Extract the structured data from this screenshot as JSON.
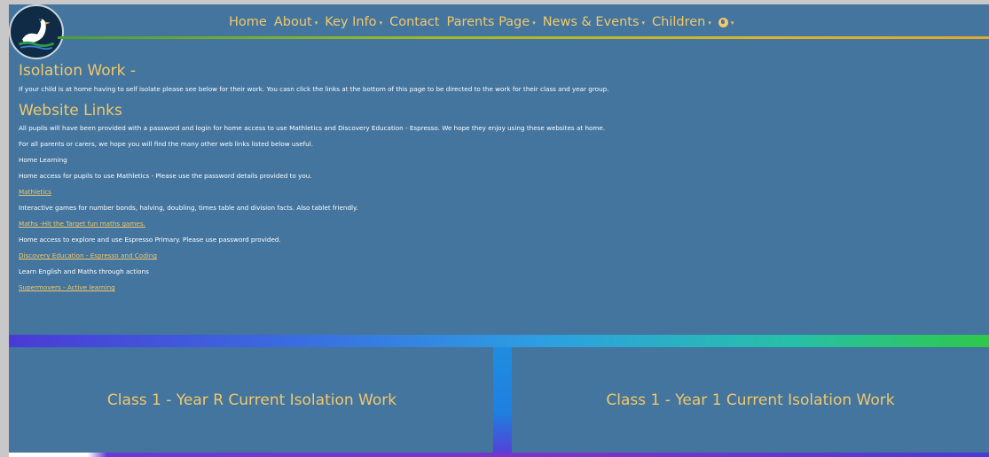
{
  "nav": {
    "items": [
      {
        "label": "Home",
        "dropdown": false
      },
      {
        "label": "About",
        "dropdown": true
      },
      {
        "label": "Key Info",
        "dropdown": true
      },
      {
        "label": "Contact",
        "dropdown": false
      },
      {
        "label": "Parents Page",
        "dropdown": true
      },
      {
        "label": "News & Events",
        "dropdown": true
      },
      {
        "label": "Children",
        "dropdown": true
      }
    ],
    "caret": "▾"
  },
  "content": {
    "isolation_title": "Isolation Work -",
    "isolation_text": "If your child is at home having to self isolate please see below for their work. You casn click the links at the bottom of this page to be directed to the work for their class and year group.",
    "links_title": "Website Links",
    "lines": [
      {
        "type": "text",
        "text": "All pupils will have been provided with a password and login for home access to use Mathletics and Discovery Education - Espresso. We hope they enjoy using these websites at home."
      },
      {
        "type": "text",
        "text": "For all parents or carers, we hope you will find the many other web links listed below useful."
      },
      {
        "type": "text",
        "text": "Home Learning"
      },
      {
        "type": "text",
        "text": "Home access for pupils to use Mathletics - Please use the password details provided to you."
      },
      {
        "type": "link",
        "text": "Mathletics"
      },
      {
        "type": "text",
        "text": "Interactive games for number bonds, halving, doubling, times table and division facts. Also tablet friendly."
      },
      {
        "type": "link",
        "text": "Maths -Hit the Target fun maths games."
      },
      {
        "type": "text",
        "text": "Home access to explore and use Espresso Primary. Please use password provided."
      },
      {
        "type": "link",
        "text": "Discovery Education - Espresso and Coding"
      },
      {
        "type": "text",
        "text": "Learn English and Maths through actions"
      },
      {
        "type": "link",
        "text": "Supermovers - Active learning"
      }
    ]
  },
  "cards": [
    {
      "label": "Class 1 - Year R Current Isolation Work"
    },
    {
      "label": "Class 1 - Year 1 Current Isolation Work"
    }
  ],
  "colors": {
    "accent": "#f3c86a",
    "background": "#43759f"
  }
}
